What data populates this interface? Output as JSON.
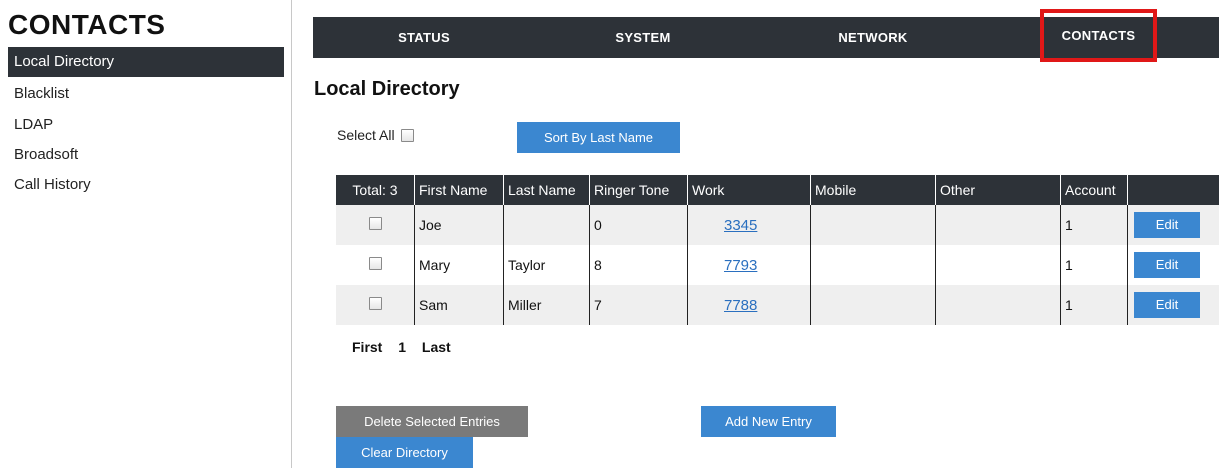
{
  "sidebar": {
    "title": "CONTACTS",
    "items": [
      {
        "label": "Local Directory",
        "active": true
      },
      {
        "label": "Blacklist",
        "active": false
      },
      {
        "label": "LDAP",
        "active": false
      },
      {
        "label": "Broadsoft",
        "active": false
      },
      {
        "label": "Call History",
        "active": false
      }
    ]
  },
  "nav": {
    "items": [
      {
        "label": "STATUS"
      },
      {
        "label": "SYSTEM"
      },
      {
        "label": "NETWORK"
      },
      {
        "label": "CONTACTS",
        "highlighted": true
      }
    ],
    "highlight_color": "#e01818"
  },
  "page": {
    "title": "Local Directory",
    "select_all_label": "Select All",
    "sort_button": "Sort By Last Name"
  },
  "table": {
    "headers": [
      "Total: 3",
      "First Name",
      "Last Name",
      "Ringer Tone",
      "Work",
      "Mobile",
      "Other",
      "Account",
      ""
    ],
    "rows": [
      {
        "first": "Joe",
        "last": "",
        "ringer": "0",
        "work": "3345",
        "mobile": "",
        "other": "",
        "account": "1",
        "action": "Edit"
      },
      {
        "first": "Mary",
        "last": "Taylor",
        "ringer": "8",
        "work": "7793",
        "mobile": "",
        "other": "",
        "account": "1",
        "action": "Edit"
      },
      {
        "first": "Sam",
        "last": "Miller",
        "ringer": "7",
        "work": "7788",
        "mobile": "",
        "other": "",
        "account": "1",
        "action": "Edit"
      }
    ]
  },
  "pager": {
    "first": "First",
    "page": "1",
    "last": "Last"
  },
  "actions": {
    "delete_selected": "Delete Selected Entries",
    "add_new": "Add New Entry",
    "clear": "Clear Directory"
  },
  "colors": {
    "dark": "#2d3238",
    "accent": "#3b87d0",
    "grey_button": "#7a7a7a"
  }
}
